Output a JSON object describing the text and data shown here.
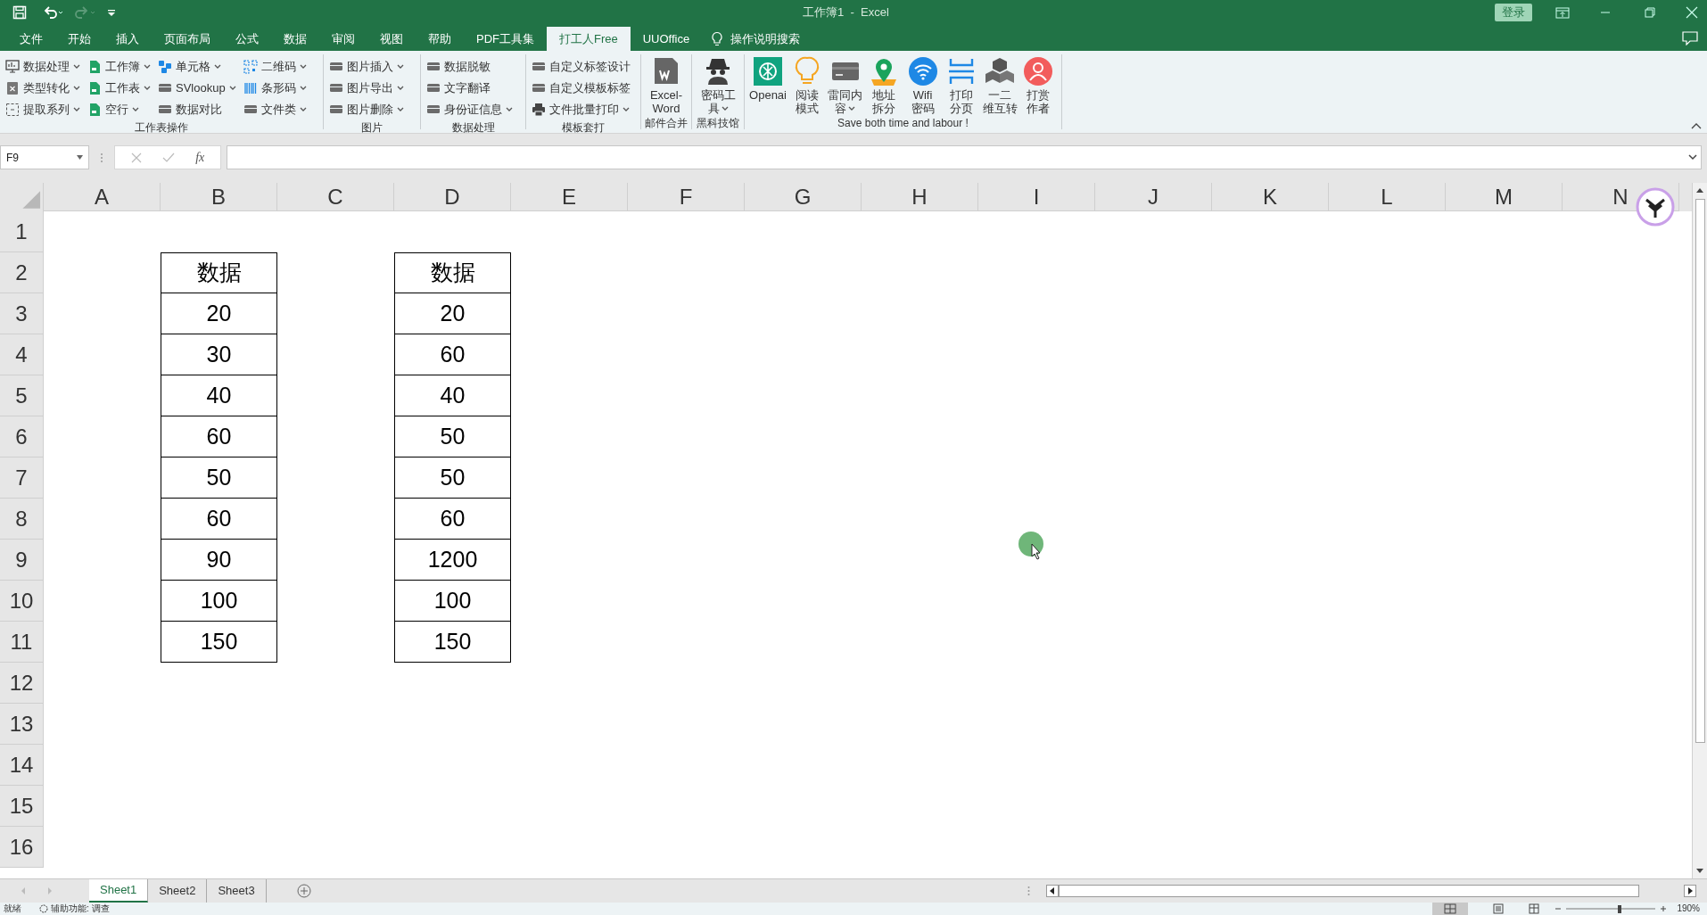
{
  "title_bar": {
    "title": "工作簿1  -  Excel",
    "login": "登录"
  },
  "menu_tabs": [
    {
      "label": "文件",
      "selected": false
    },
    {
      "label": "开始",
      "selected": false
    },
    {
      "label": "插入",
      "selected": false
    },
    {
      "label": "页面布局",
      "selected": false
    },
    {
      "label": "公式",
      "selected": false
    },
    {
      "label": "数据",
      "selected": false
    },
    {
      "label": "审阅",
      "selected": false
    },
    {
      "label": "视图",
      "selected": false
    },
    {
      "label": "帮助",
      "selected": false
    },
    {
      "label": "PDF工具集",
      "selected": false
    },
    {
      "label": "打工人Free",
      "selected": true
    },
    {
      "label": "UUOffice",
      "selected": false
    }
  ],
  "tell_me": "操作说明搜索",
  "ribbon_groups": [
    {
      "kind": "small",
      "label": "工作表操作",
      "items": [
        {
          "label": "数据处理",
          "dropdown": true
        },
        {
          "label": "类型转化",
          "dropdown": true
        },
        {
          "label": "提取系列",
          "dropdown": true
        },
        {
          "label": "工作簿",
          "dropdown": true
        },
        {
          "label": "工作表",
          "dropdown": true
        },
        {
          "label": "空行",
          "dropdown": true
        },
        {
          "label": "单元格",
          "dropdown": true
        },
        {
          "label": "SVlookup",
          "dropdown": true
        },
        {
          "label": "数据对比",
          "dropdown": false
        },
        {
          "label": "二维码",
          "dropdown": true
        },
        {
          "label": "条形码",
          "dropdown": true
        },
        {
          "label": "文件类",
          "dropdown": true
        }
      ]
    },
    {
      "kind": "small",
      "label": "图片",
      "items": [
        {
          "label": "图片插入",
          "dropdown": true
        },
        {
          "label": "图片导出",
          "dropdown": true
        },
        {
          "label": "图片删除",
          "dropdown": true
        }
      ]
    },
    {
      "kind": "small",
      "label": "数据处理",
      "items": [
        {
          "label": "数据脱敏",
          "dropdown": false
        },
        {
          "label": "文字翻译",
          "dropdown": false
        },
        {
          "label": "身份证信息",
          "dropdown": true
        }
      ]
    },
    {
      "kind": "small",
      "label": "模板套打",
      "items": [
        {
          "label": "自定义标签设计",
          "dropdown": false
        },
        {
          "label": "自定义模板标签",
          "dropdown": false
        },
        {
          "label": "文件批量打印",
          "dropdown": true
        }
      ]
    },
    {
      "kind": "large",
      "label": "邮件合并",
      "items": [
        {
          "lines": [
            "Excel-",
            "Word"
          ],
          "dropdown": false
        }
      ]
    },
    {
      "kind": "large",
      "label": "黑科技馆",
      "items": [
        {
          "lines": [
            "密码工",
            "具"
          ],
          "dropdown": true
        }
      ]
    },
    {
      "kind": "large",
      "label": "Save both time and labour !",
      "items": [
        {
          "lines": [
            "Openai"
          ],
          "dropdown": false
        },
        {
          "lines": [
            "阅读",
            "模式"
          ],
          "dropdown": false
        },
        {
          "lines": [
            "雷同内",
            "容"
          ],
          "dropdown": true
        },
        {
          "lines": [
            "地址",
            "拆分"
          ],
          "dropdown": false
        },
        {
          "lines": [
            "Wifi",
            "密码"
          ],
          "dropdown": false
        },
        {
          "lines": [
            "打印",
            "分页"
          ],
          "dropdown": false
        },
        {
          "lines": [
            "一二",
            "维互转"
          ],
          "dropdown": false
        },
        {
          "lines": [
            "打赏",
            "作者"
          ],
          "dropdown": false
        }
      ]
    }
  ],
  "formula_bar": {
    "name_box": "F9",
    "function_label": "fx"
  },
  "columns": [
    "A",
    "B",
    "C",
    "D",
    "E",
    "F",
    "G",
    "H",
    "I",
    "J",
    "K",
    "L",
    "M",
    "N"
  ],
  "rows": [
    "1",
    "2",
    "3",
    "4",
    "5",
    "6",
    "7",
    "8",
    "9",
    "10",
    "11",
    "12",
    "13",
    "14",
    "15",
    "16"
  ],
  "tables": [
    {
      "header": "数据",
      "values": [
        "20",
        "30",
        "40",
        "60",
        "50",
        "60",
        "90",
        "100",
        "150"
      ]
    },
    {
      "header": "数据",
      "values": [
        "20",
        "60",
        "40",
        "50",
        "50",
        "60",
        "1200",
        "100",
        "150"
      ]
    }
  ],
  "sheet_tabs": [
    {
      "label": "Sheet1",
      "selected": true
    },
    {
      "label": "Sheet2",
      "selected": false
    },
    {
      "label": "Sheet3",
      "selected": false
    }
  ],
  "status_bar": {
    "status": "就绪",
    "accessibility": "辅助功能: 调查",
    "zoom": "190%"
  }
}
